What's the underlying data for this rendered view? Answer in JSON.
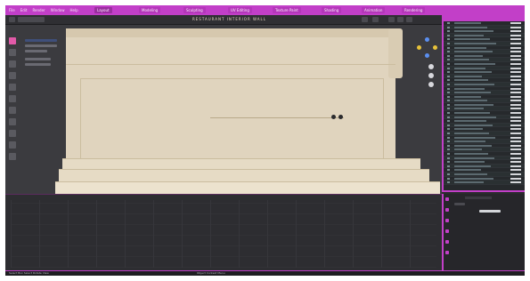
{
  "app": {
    "menu": [
      "File",
      "Edit",
      "Render",
      "Window",
      "Help"
    ],
    "tabs": [
      "Layout",
      "Modeling",
      "Sculpting",
      "UV Editing",
      "Texture Paint",
      "Shading",
      "Animation",
      "Rendering"
    ]
  },
  "header": {
    "title": "RESTAURANT INTERIOR WALL"
  },
  "colors": {
    "accent": "#c23fc8",
    "wall": "#e0d4be",
    "panel_bg": "#2b2b2e"
  },
  "status": {
    "left": "Select  Box Select  Rotate View",
    "center": "Object Context Menu"
  }
}
